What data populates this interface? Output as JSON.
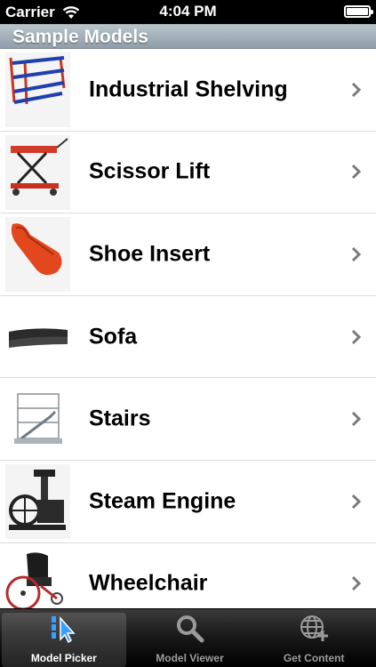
{
  "status_bar": {
    "carrier": "Carrier",
    "time": "4:04 PM"
  },
  "section_header": {
    "title": "Sample Models"
  },
  "models": [
    {
      "label": "Industrial Shelving",
      "icon": "industrial-shelving-thumbnail"
    },
    {
      "label": "Scissor Lift",
      "icon": "scissor-lift-thumbnail"
    },
    {
      "label": "Shoe Insert",
      "icon": "shoe-insert-thumbnail"
    },
    {
      "label": "Sofa",
      "icon": "sofa-thumbnail"
    },
    {
      "label": "Stairs",
      "icon": "stairs-thumbnail"
    },
    {
      "label": "Steam Engine",
      "icon": "steam-engine-thumbnail"
    },
    {
      "label": "Wheelchair",
      "icon": "wheelchair-thumbnail"
    }
  ],
  "tab_bar": {
    "tabs": [
      {
        "label": "Model Picker",
        "icon": "cursor-icon",
        "selected": true
      },
      {
        "label": "Model Viewer",
        "icon": "magnifier-icon",
        "selected": false
      },
      {
        "label": "Get Content",
        "icon": "globe-plus-icon",
        "selected": false
      }
    ]
  },
  "colors": {
    "header_gradient_top": "#b9c4cc",
    "header_gradient_bottom": "#8f9ea9",
    "tab_active_blue": "#3aa0ff"
  }
}
